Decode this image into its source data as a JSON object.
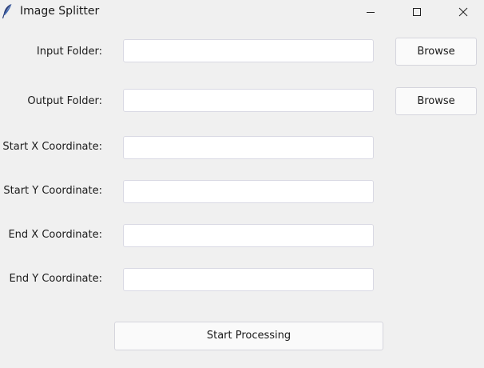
{
  "window": {
    "title": "Image Splitter",
    "icon": "feather-icon",
    "controls": [
      "minimize-icon",
      "maximize-icon",
      "close-icon"
    ]
  },
  "form": {
    "input_folder": {
      "label": "Input Folder:",
      "value": "",
      "browse_label": "Browse"
    },
    "output_folder": {
      "label": "Output Folder:",
      "value": "",
      "browse_label": "Browse"
    },
    "start_x": {
      "label": "Start X Coordinate:",
      "value": ""
    },
    "start_y": {
      "label": "Start Y Coordinate:",
      "value": ""
    },
    "end_x": {
      "label": "End X Coordinate:",
      "value": ""
    },
    "end_y": {
      "label": "End Y Coordinate:",
      "value": ""
    }
  },
  "actions": {
    "start_label": "Start Processing"
  }
}
